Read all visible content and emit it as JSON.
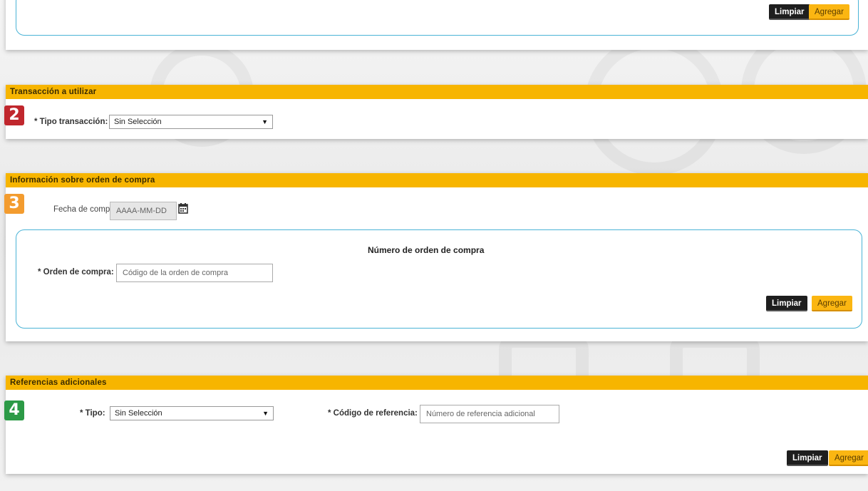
{
  "section1": {
    "clear_label": "Limpiar",
    "add_label": "Agregar"
  },
  "section2": {
    "badge": "2",
    "header": "Transacción a utilizar",
    "type_label": "* Tipo transacción:",
    "type_value": "Sin Selección"
  },
  "section3": {
    "badge": "3",
    "header": "Información sobre orden de compra",
    "date_label": "Fecha de compra:",
    "date_placeholder": "AAAA-MM-DD",
    "subbox_title": "Número de orden de compra",
    "order_label": "* Orden de compra:",
    "order_placeholder": "Código de la orden de compra",
    "clear_label": "Limpiar",
    "add_label": "Agregar"
  },
  "section4": {
    "badge": "4",
    "header": "Referencias adicionales",
    "type_label": "* Tipo:",
    "type_value": "Sin Selección",
    "ref_label": "* Código de referencia:",
    "ref_placeholder": "Número de referencia adicional",
    "clear_label": "Limpiar",
    "add_label": "Agregar"
  },
  "colors": {
    "header": "#f7b500",
    "badge2": "#c0272d",
    "badge3": "#f39c2f",
    "badge4": "#2c9a46",
    "accent_border": "#4ab3d6"
  }
}
